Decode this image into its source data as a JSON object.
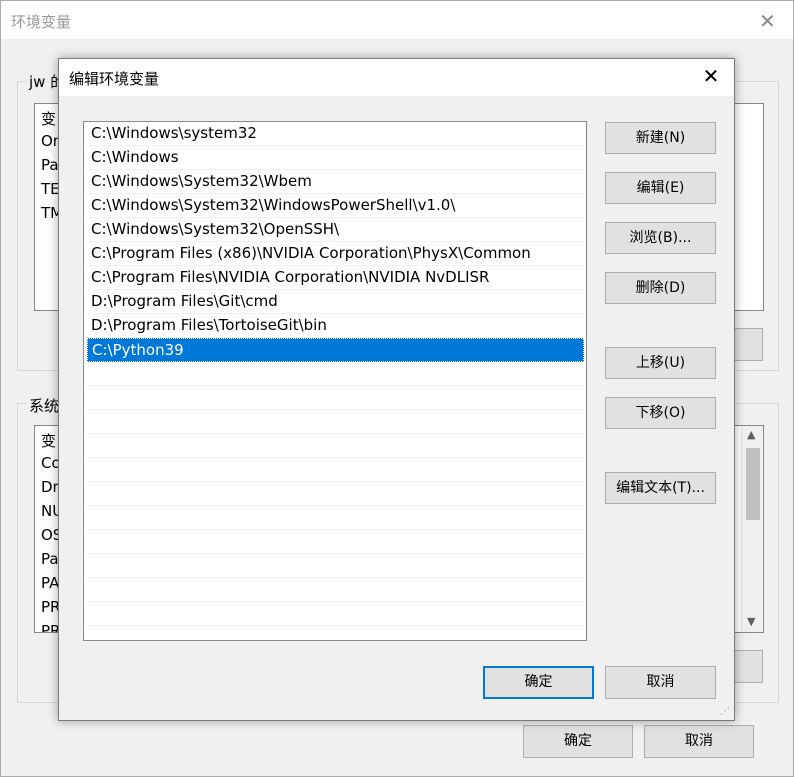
{
  "parent": {
    "title": "环境变量",
    "user_group_label": "jw 的",
    "user_list_items": [
      "变",
      "On",
      "Pa",
      "TE",
      "TM"
    ],
    "system_group_label": "系统",
    "system_list_items": [
      "变",
      "Co",
      "Dr",
      "NU",
      "OS",
      "Pa",
      "PA",
      "PR",
      "PR"
    ],
    "ok_label": "确定",
    "cancel_label": "取消"
  },
  "dialog": {
    "title": "编辑环境变量",
    "paths": [
      "C:\\Windows\\system32",
      "C:\\Windows",
      "C:\\Windows\\System32\\Wbem",
      "C:\\Windows\\System32\\WindowsPowerShell\\v1.0\\",
      "C:\\Windows\\System32\\OpenSSH\\",
      "C:\\Program Files (x86)\\NVIDIA Corporation\\PhysX\\Common",
      "C:\\Program Files\\NVIDIA Corporation\\NVIDIA NvDLISR",
      "D:\\Program Files\\Git\\cmd",
      "D:\\Program Files\\TortoiseGit\\bin",
      "C:\\Python39"
    ],
    "selected_index": 9,
    "buttons": {
      "new": "新建(N)",
      "edit": "编辑(E)",
      "browse": "浏览(B)...",
      "delete": "删除(D)",
      "move_up": "上移(U)",
      "move_down": "下移(O)",
      "edit_text": "编辑文本(T)..."
    },
    "ok_label": "确定",
    "cancel_label": "取消"
  }
}
